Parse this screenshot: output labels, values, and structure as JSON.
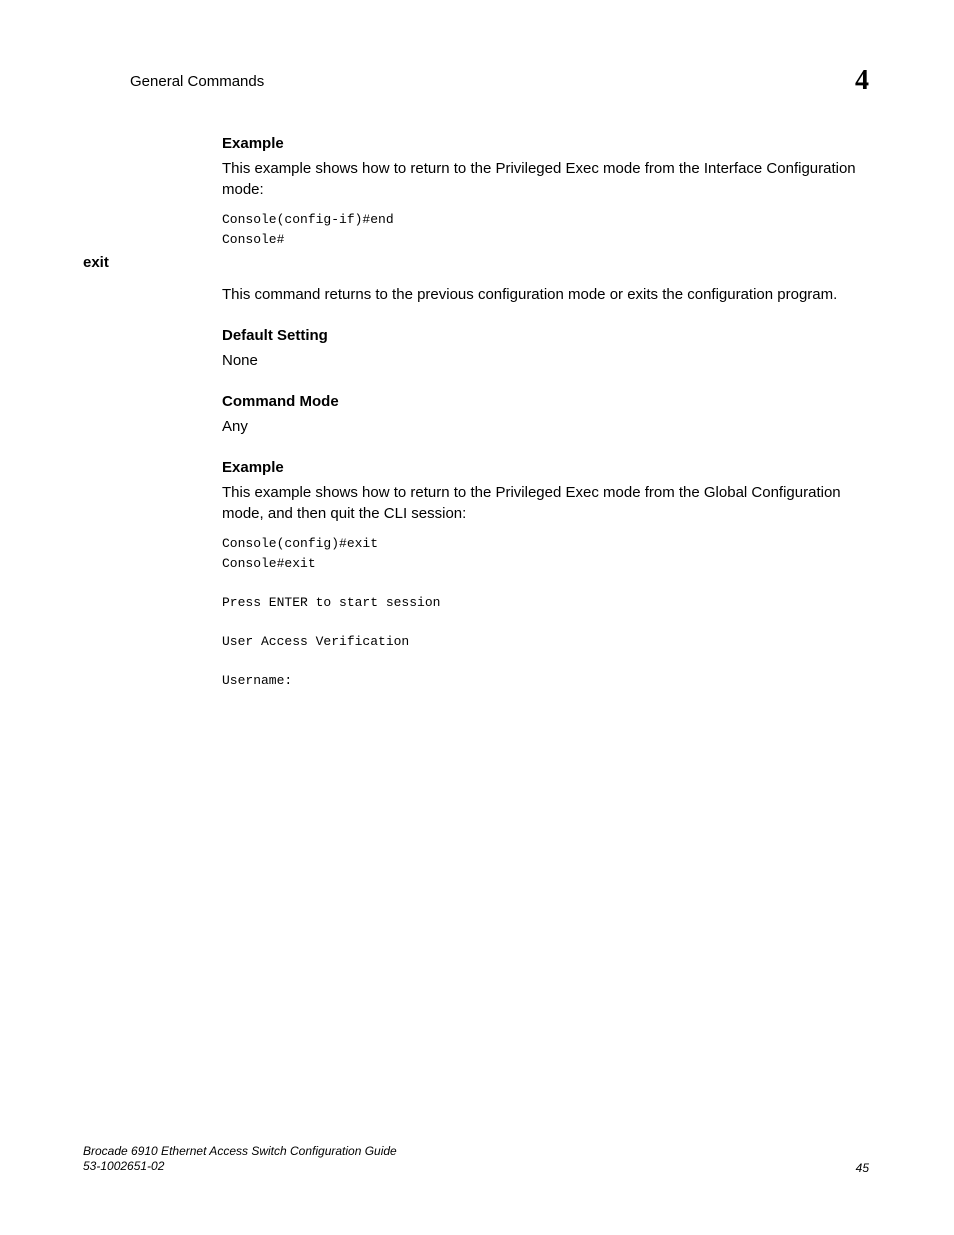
{
  "header": {
    "title": "General Commands",
    "chapter": "4"
  },
  "sections": {
    "example1": {
      "heading": "Example",
      "text": "This example shows how to return to the Privileged Exec mode from the Interface Configuration mode:",
      "code": "Console(config-if)#end\nConsole#"
    },
    "exit": {
      "sideHeading": "exit",
      "description": "This command returns to the previous configuration mode or exits the configuration program.",
      "defaultSetting": {
        "heading": "Default Setting",
        "value": "None"
      },
      "commandMode": {
        "heading": "Command Mode",
        "value": "Any"
      },
      "example": {
        "heading": "Example",
        "text": "This example shows how to return to the Privileged Exec mode from the Global Configuration mode, and then quit the CLI session:",
        "code": "Console(config)#exit\nConsole#exit\n\nPress ENTER to start session\n\nUser Access Verification\n\nUsername:"
      }
    }
  },
  "footer": {
    "guideTitle": "Brocade 6910 Ethernet Access Switch Configuration Guide",
    "docNumber": "53-1002651-02",
    "pageNumber": "45"
  }
}
